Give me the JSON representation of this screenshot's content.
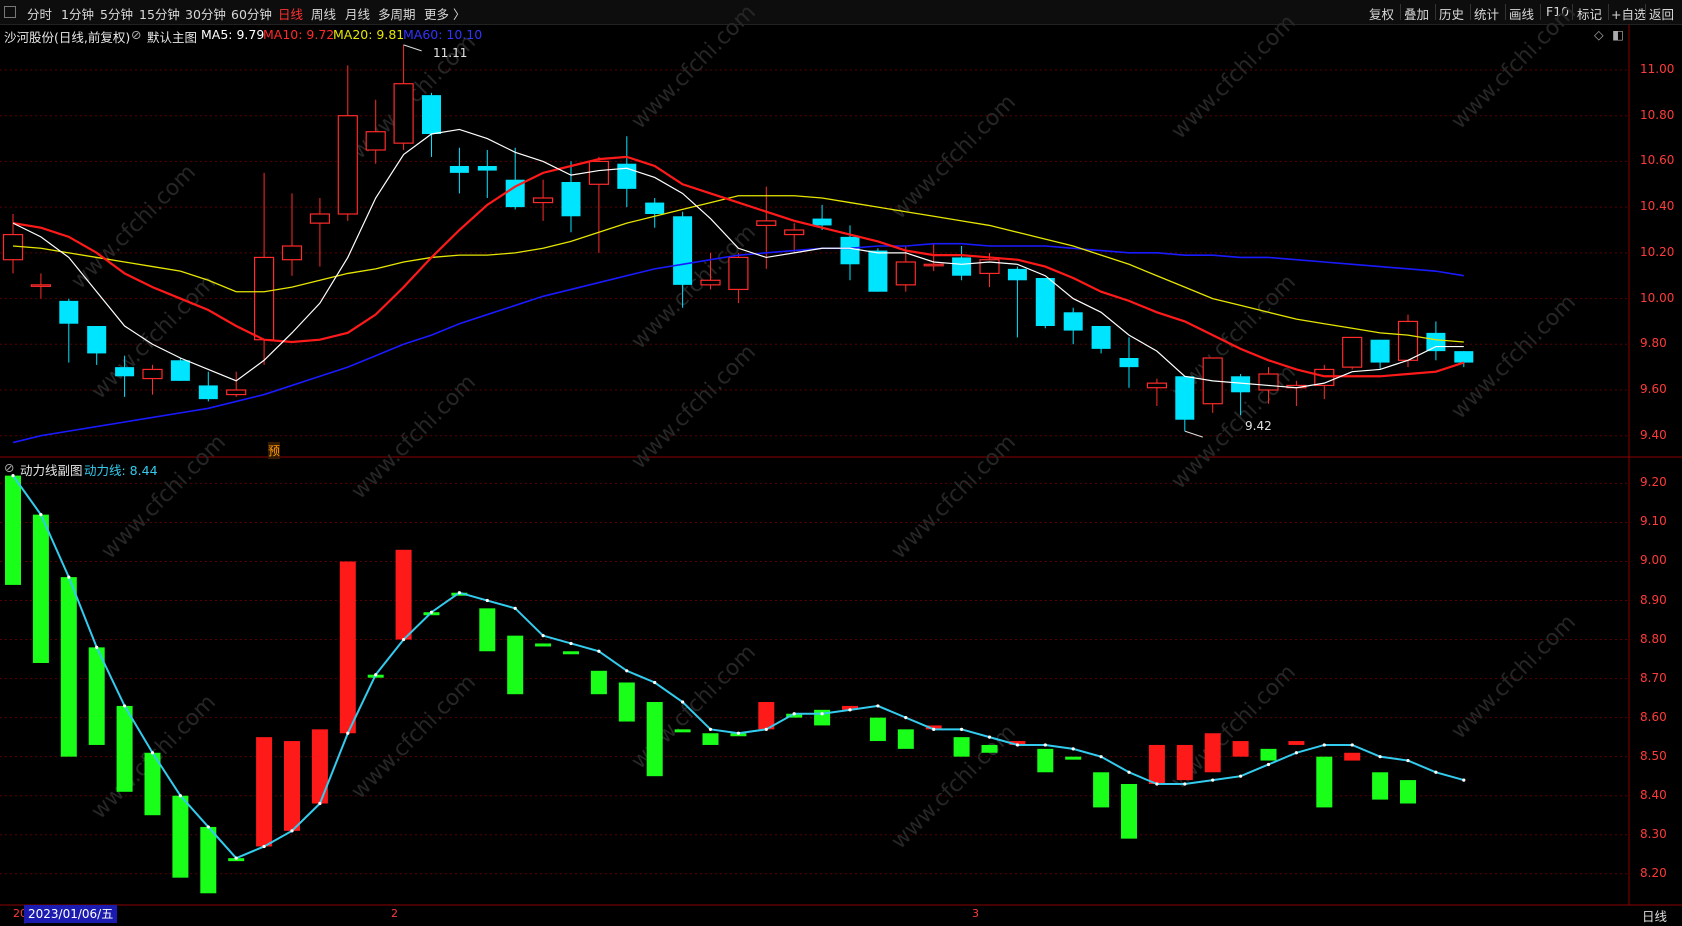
{
  "toolbar": {
    "periods": [
      "分时",
      "1分钟",
      "5分钟",
      "15分钟",
      "30分钟",
      "60分钟",
      "日线",
      "周线",
      "月线",
      "多周期",
      "更多 〉"
    ],
    "active_period": "日线",
    "tools": [
      "复权",
      "叠加",
      "历史",
      "统计",
      "画线",
      "F10",
      "标记",
      "+自选",
      "返回"
    ]
  },
  "main_chart": {
    "stock_title": "沙河股份(日线,前复权)",
    "indicator_name": "默认主图",
    "ma5_label": "MA5: 9.79",
    "ma10_label": "MA10: 9.72",
    "ma20_label": "MA20: 9.81",
    "ma60_label": "MA60: 10.10",
    "high_marker": "11.11",
    "low_marker": "9.42",
    "pre_tag": "预",
    "y_ticks": [
      "11.00",
      "10.80",
      "10.60",
      "10.40",
      "10.20",
      "10.00",
      "9.80",
      "9.60",
      "9.40"
    ],
    "colors": {
      "up": "#ff2a2a",
      "down": "#00e5ff",
      "ma5": "#ffffff",
      "ma10": "#ff1a1a",
      "ma20": "#e6e600",
      "ma60": "#1a1aff"
    }
  },
  "sub_chart": {
    "indicator_name": "动力线副图",
    "line_label": "动力线: 8.44",
    "y_ticks": [
      "9.20",
      "9.10",
      "9.00",
      "8.90",
      "8.80",
      "8.70",
      "8.60",
      "8.50",
      "8.40",
      "8.30",
      "8.20"
    ],
    "colors": {
      "up": "#ff1a1a",
      "down": "#1aff1a",
      "line": "#33ccee"
    }
  },
  "bottom": {
    "date_label": "2023/01/06/五",
    "month_marks": [
      "20",
      "2",
      "3"
    ],
    "tab_label": "日线"
  },
  "watermark": "www.cfchi.com",
  "chart_data": {
    "type": "candlestick",
    "ohlc": [
      [
        10.17,
        10.28,
        10.37,
        10.11
      ],
      [
        10.06,
        10.06,
        10.11,
        10.0
      ],
      [
        9.99,
        9.89,
        10.0,
        9.72
      ],
      [
        9.88,
        9.76,
        9.88,
        9.71
      ],
      [
        9.7,
        9.66,
        9.75,
        9.57
      ],
      [
        9.65,
        9.69,
        9.71,
        9.58
      ],
      [
        9.73,
        9.64,
        9.74,
        9.64
      ],
      [
        9.62,
        9.56,
        9.68,
        9.55
      ],
      [
        9.58,
        9.6,
        9.68,
        9.57
      ],
      [
        9.82,
        10.18,
        10.55,
        9.71
      ],
      [
        10.17,
        10.23,
        10.46,
        10.1
      ],
      [
        10.33,
        10.37,
        10.44,
        10.14
      ],
      [
        10.37,
        10.8,
        11.02,
        10.34
      ],
      [
        10.65,
        10.73,
        10.87,
        10.59
      ],
      [
        10.68,
        10.94,
        11.11,
        10.65
      ],
      [
        10.89,
        10.72,
        10.9,
        10.62
      ],
      [
        10.58,
        10.55,
        10.66,
        10.46
      ],
      [
        10.58,
        10.56,
        10.65,
        10.44
      ],
      [
        10.52,
        10.4,
        10.66,
        10.39
      ],
      [
        10.42,
        10.44,
        10.52,
        10.34
      ],
      [
        10.51,
        10.36,
        10.6,
        10.29
      ],
      [
        10.5,
        10.6,
        10.62,
        10.2
      ],
      [
        10.59,
        10.48,
        10.71,
        10.4
      ],
      [
        10.42,
        10.37,
        10.44,
        10.31
      ],
      [
        10.36,
        10.06,
        10.38,
        9.96
      ],
      [
        10.06,
        10.08,
        10.2,
        10.04
      ],
      [
        10.04,
        10.18,
        10.2,
        9.98
      ],
      [
        10.32,
        10.34,
        10.49,
        10.13
      ],
      [
        10.28,
        10.3,
        10.33,
        10.2
      ],
      [
        10.35,
        10.32,
        10.41,
        10.3
      ],
      [
        10.27,
        10.15,
        10.32,
        10.08
      ],
      [
        10.21,
        10.03,
        10.22,
        10.03
      ],
      [
        10.06,
        10.16,
        10.23,
        10.03
      ],
      [
        10.15,
        10.15,
        10.24,
        10.12
      ],
      [
        10.18,
        10.1,
        10.23,
        10.08
      ],
      [
        10.11,
        10.17,
        10.2,
        10.05
      ],
      [
        10.13,
        10.08,
        10.14,
        9.83
      ],
      [
        10.09,
        9.88,
        10.09,
        9.87
      ],
      [
        9.94,
        9.86,
        9.96,
        9.8
      ],
      [
        9.88,
        9.78,
        9.88,
        9.76
      ],
      [
        9.74,
        9.7,
        9.83,
        9.61
      ],
      [
        9.61,
        9.63,
        9.65,
        9.53
      ],
      [
        9.66,
        9.47,
        9.66,
        9.42
      ],
      [
        9.54,
        9.74,
        9.74,
        9.5
      ],
      [
        9.66,
        9.59,
        9.67,
        9.49
      ],
      [
        9.6,
        9.67,
        9.7,
        9.54
      ],
      [
        9.61,
        9.62,
        9.64,
        9.53
      ],
      [
        9.62,
        9.69,
        9.71,
        9.56
      ],
      [
        9.7,
        9.83,
        9.83,
        9.69
      ],
      [
        9.82,
        9.72,
        9.82,
        9.69
      ],
      [
        9.73,
        9.9,
        9.93,
        9.7
      ],
      [
        9.85,
        9.77,
        9.9,
        9.73
      ],
      [
        9.77,
        9.72,
        9.77,
        9.7
      ]
    ],
    "ma5": [
      10.33,
      10.27,
      10.18,
      10.03,
      9.88,
      9.8,
      9.74,
      9.69,
      9.64,
      9.73,
      9.85,
      9.98,
      10.18,
      10.44,
      10.63,
      10.72,
      10.74,
      10.7,
      10.64,
      10.6,
      10.54,
      10.56,
      10.57,
      10.53,
      10.46,
      10.35,
      10.22,
      10.18,
      10.2,
      10.22,
      10.22,
      10.2,
      10.2,
      10.16,
      10.15,
      10.16,
      10.15,
      10.1,
      10.0,
      9.94,
      9.84,
      9.77,
      9.66,
      9.64,
      9.63,
      9.62,
      9.61,
      9.63,
      9.68,
      9.69,
      9.73,
      9.79,
      9.79
    ],
    "ma10": [
      10.33,
      10.31,
      10.27,
      10.2,
      10.11,
      10.05,
      10.0,
      9.95,
      9.88,
      9.82,
      9.81,
      9.82,
      9.85,
      9.93,
      10.05,
      10.18,
      10.3,
      10.41,
      10.49,
      10.55,
      10.58,
      10.61,
      10.62,
      10.58,
      10.5,
      10.46,
      10.42,
      10.38,
      10.34,
      10.31,
      10.28,
      10.25,
      10.21,
      10.19,
      10.19,
      10.18,
      10.17,
      10.14,
      10.09,
      10.03,
      9.99,
      9.94,
      9.9,
      9.84,
      9.78,
      9.73,
      9.69,
      9.66,
      9.66,
      9.66,
      9.67,
      9.68,
      9.72
    ],
    "ma20": [
      10.23,
      10.22,
      10.2,
      10.18,
      10.16,
      10.14,
      10.12,
      10.08,
      10.03,
      10.03,
      10.05,
      10.08,
      10.11,
      10.13,
      10.16,
      10.18,
      10.19,
      10.19,
      10.2,
      10.22,
      10.25,
      10.29,
      10.33,
      10.36,
      10.39,
      10.42,
      10.45,
      10.45,
      10.45,
      10.44,
      10.42,
      10.4,
      10.38,
      10.36,
      10.34,
      10.32,
      10.29,
      10.26,
      10.23,
      10.19,
      10.15,
      10.1,
      10.05,
      10.0,
      9.97,
      9.94,
      9.91,
      9.89,
      9.87,
      9.85,
      9.84,
      9.82,
      9.81
    ],
    "ma60": [
      9.37,
      9.4,
      9.42,
      9.44,
      9.46,
      9.48,
      9.5,
      9.52,
      9.55,
      9.58,
      9.62,
      9.66,
      9.7,
      9.75,
      9.8,
      9.84,
      9.89,
      9.93,
      9.97,
      10.01,
      10.04,
      10.07,
      10.1,
      10.13,
      10.15,
      10.17,
      10.19,
      10.2,
      10.21,
      10.22,
      10.22,
      10.23,
      10.23,
      10.24,
      10.24,
      10.23,
      10.23,
      10.23,
      10.22,
      10.21,
      10.2,
      10.2,
      10.19,
      10.19,
      10.18,
      10.18,
      10.17,
      10.16,
      10.15,
      10.14,
      10.13,
      10.12,
      10.1
    ],
    "power_line": [
      9.22,
      9.12,
      8.96,
      8.78,
      8.63,
      8.51,
      8.4,
      8.32,
      8.24,
      8.27,
      8.31,
      8.38,
      8.56,
      8.71,
      8.8,
      8.87,
      8.92,
      8.9,
      8.88,
      8.81,
      8.79,
      8.77,
      8.72,
      8.69,
      8.64,
      8.57,
      8.56,
      8.57,
      8.61,
      8.61,
      8.62,
      8.63,
      8.6,
      8.57,
      8.57,
      8.55,
      8.53,
      8.53,
      8.52,
      8.5,
      8.46,
      8.43,
      8.43,
      8.44,
      8.45,
      8.48,
      8.51,
      8.53,
      8.53,
      8.5,
      8.49,
      8.46,
      8.44
    ],
    "power_bars": [
      [
        9.22,
        8.94
      ],
      [
        9.12,
        8.74
      ],
      [
        8.96,
        8.5
      ],
      [
        8.78,
        8.53
      ],
      [
        8.63,
        8.41
      ],
      [
        8.51,
        8.35
      ],
      [
        8.4,
        8.19
      ],
      [
        8.32,
        8.15
      ],
      [
        8.24,
        8.24
      ],
      [
        8.27,
        8.55
      ],
      [
        8.31,
        8.54
      ],
      [
        8.38,
        8.57
      ],
      [
        8.56,
        9.0
      ],
      [
        8.71,
        8.71
      ],
      [
        8.8,
        9.03
      ],
      [
        8.87,
        8.87
      ],
      [
        8.92,
        8.92
      ],
      [
        8.88,
        8.77
      ],
      [
        8.81,
        8.66
      ],
      [
        8.79,
        8.79
      ],
      [
        8.77,
        8.77
      ],
      [
        8.72,
        8.66
      ],
      [
        8.69,
        8.59
      ],
      [
        8.64,
        8.45
      ],
      [
        8.57,
        8.57
      ],
      [
        8.56,
        8.53
      ],
      [
        8.56,
        8.56
      ],
      [
        8.57,
        8.64
      ],
      [
        8.61,
        8.6
      ],
      [
        8.62,
        8.58
      ],
      [
        8.62,
        8.63
      ],
      [
        8.6,
        8.54
      ],
      [
        8.57,
        8.52
      ],
      [
        8.57,
        8.58
      ],
      [
        8.55,
        8.5
      ],
      [
        8.53,
        8.51
      ],
      [
        8.53,
        8.54
      ],
      [
        8.52,
        8.46
      ],
      [
        8.5,
        8.5
      ],
      [
        8.46,
        8.37
      ],
      [
        8.43,
        8.29
      ],
      [
        8.43,
        8.53
      ],
      [
        8.44,
        8.53
      ],
      [
        8.46,
        8.56
      ],
      [
        8.5,
        8.54
      ],
      [
        8.52,
        8.49
      ],
      [
        8.53,
        8.54
      ],
      [
        8.5,
        8.37
      ],
      [
        8.49,
        8.51
      ],
      [
        8.46,
        8.39
      ],
      [
        8.44,
        8.38
      ]
    ],
    "y_range_main": [
      9.32,
      11.14
    ],
    "y_range_sub": [
      8.12,
      9.26
    ]
  }
}
